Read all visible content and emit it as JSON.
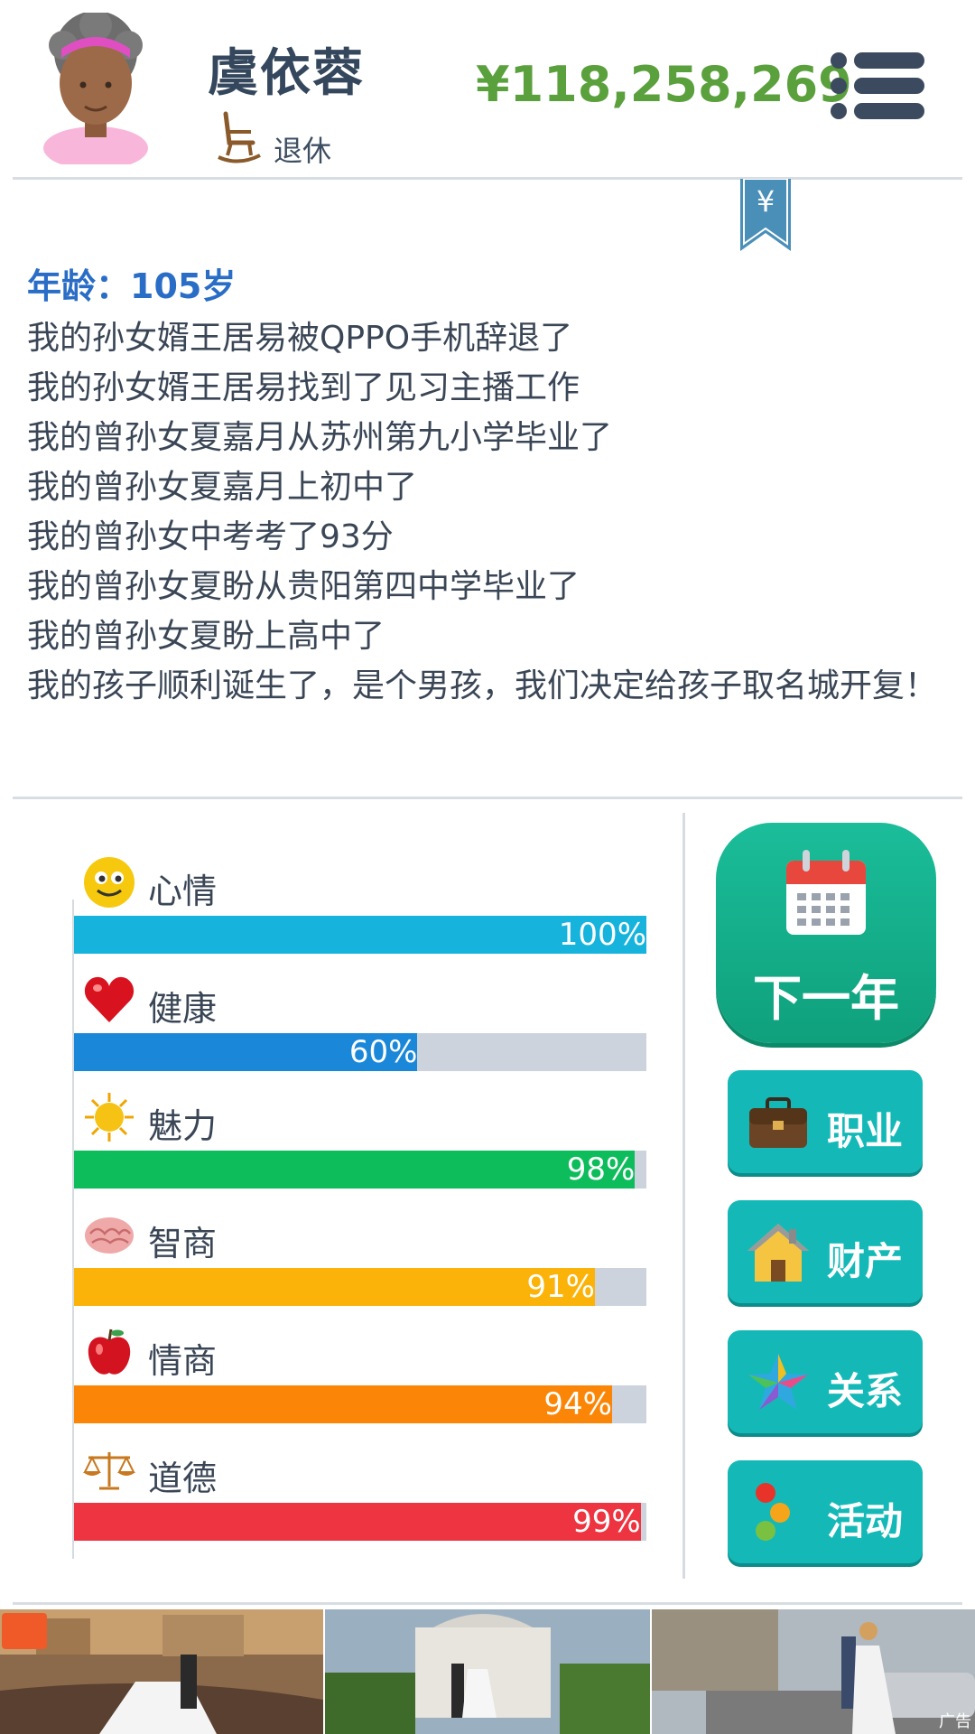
{
  "profile": {
    "name": "虞依蓉",
    "job": "退休",
    "money": "¥118,258,269"
  },
  "log": {
    "age": "年龄：105岁",
    "events": [
      "我的孙女婿王居易被QPPO手机辞退了",
      "我的孙女婿王居易找到了见习主播工作",
      "我的曾孙女夏嘉月从苏州第九小学毕业了",
      "我的曾孙女夏嘉月上初中了",
      "我的曾孙女中考考了93分",
      "我的曾孙女夏盼从贵阳第四中学毕业了",
      "我的曾孙女夏盼上高中了",
      "我的孩子顺利诞生了，是个男孩，我们决定给孩子取名城开复！"
    ]
  },
  "stats": [
    {
      "label": "心情",
      "percent": 100,
      "text": "100%",
      "color": "#16b3dd",
      "icon": "smiley-icon"
    },
    {
      "label": "健康",
      "percent": 60,
      "text": "60%",
      "color": "#1a87d8",
      "icon": "heart-icon"
    },
    {
      "label": "魅力",
      "percent": 98,
      "text": "98%",
      "color": "#0dbc5a",
      "icon": "sun-icon"
    },
    {
      "label": "智商",
      "percent": 91,
      "text": "91%",
      "color": "#fbb30a",
      "icon": "brain-icon"
    },
    {
      "label": "情商",
      "percent": 94,
      "text": "94%",
      "color": "#fb8506",
      "icon": "apple-icon"
    },
    {
      "label": "道德",
      "percent": 99,
      "text": "99%",
      "color": "#ee3440",
      "icon": "scales-icon"
    }
  ],
  "actions": {
    "next_year": "下一年",
    "career": "职业",
    "assets": "财产",
    "relations": "关系",
    "activities": "活动"
  },
  "ad": {
    "mark": "广告"
  },
  "colors": {
    "money": "#5aa03c",
    "age": "#2a6dc6",
    "button": "#14b9b7",
    "next_button": "#12ad8a"
  }
}
